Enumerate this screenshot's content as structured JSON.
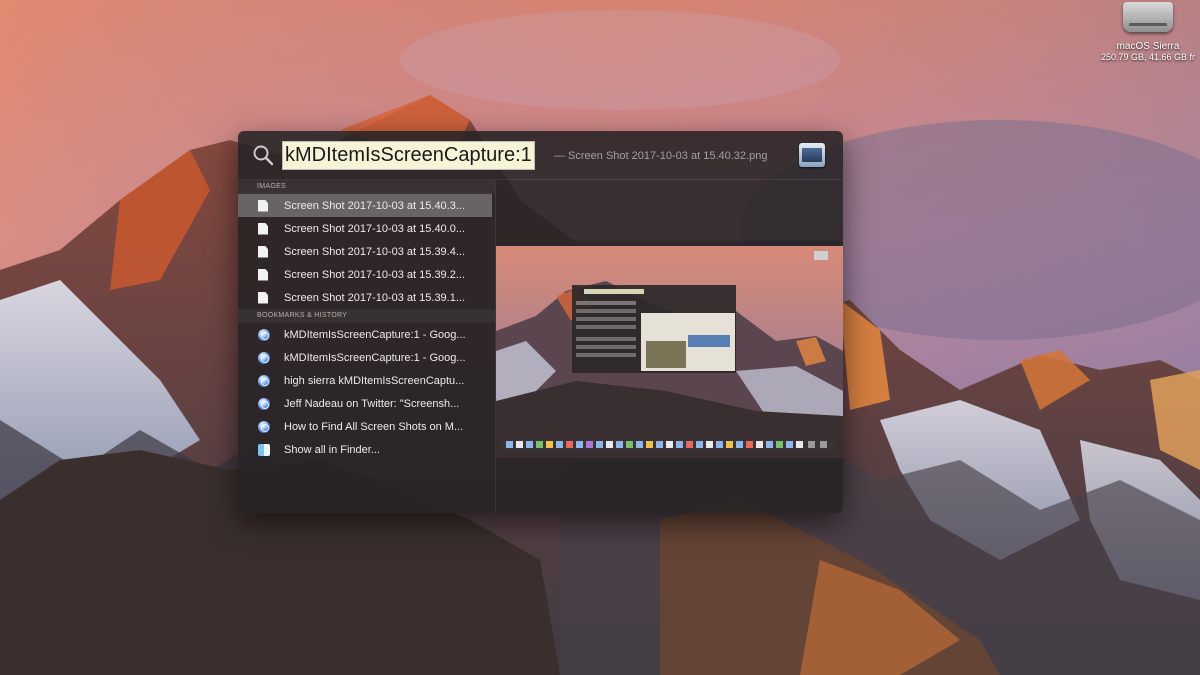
{
  "desktop": {
    "drive_name": "macOS Sierra",
    "drive_sub": "250.79 GB, 41.66 GB fr"
  },
  "spotlight": {
    "query": "kMDItemIsScreenCapture:1",
    "suffix": "— Screen Shot 2017-10-03 at 15.40.32.png",
    "sections": [
      {
        "header": "IMAGES",
        "items": [
          {
            "label": "Screen Shot 2017-10-03 at 15.40.3...",
            "icon": "file-icon",
            "selected": true
          },
          {
            "label": "Screen Shot 2017-10-03 at 15.40.0...",
            "icon": "file-icon",
            "selected": false
          },
          {
            "label": "Screen Shot 2017-10-03 at 15.39.4...",
            "icon": "file-icon",
            "selected": false
          },
          {
            "label": "Screen Shot 2017-10-03 at 15.39.2...",
            "icon": "file-icon",
            "selected": false
          },
          {
            "label": "Screen Shot 2017-10-03 at 15.39.1...",
            "icon": "file-icon",
            "selected": false
          }
        ]
      },
      {
        "header": "BOOKMARKS & HISTORY",
        "items": [
          {
            "label": "kMDItemIsScreenCapture:1 - Goog...",
            "icon": "safari-icon"
          },
          {
            "label": "kMDItemIsScreenCapture:1 - Goog...",
            "icon": "safari-icon"
          },
          {
            "label": "high sierra kMDItemIsScreenCaptu...",
            "icon": "safari-icon"
          },
          {
            "label": "Jeff Nadeau on Twitter: \"Screensh...",
            "icon": "safari-icon"
          },
          {
            "label": "How to Find All Screen Shots on M...",
            "icon": "safari-icon"
          }
        ]
      }
    ],
    "show_all": "Show all in Finder..."
  }
}
